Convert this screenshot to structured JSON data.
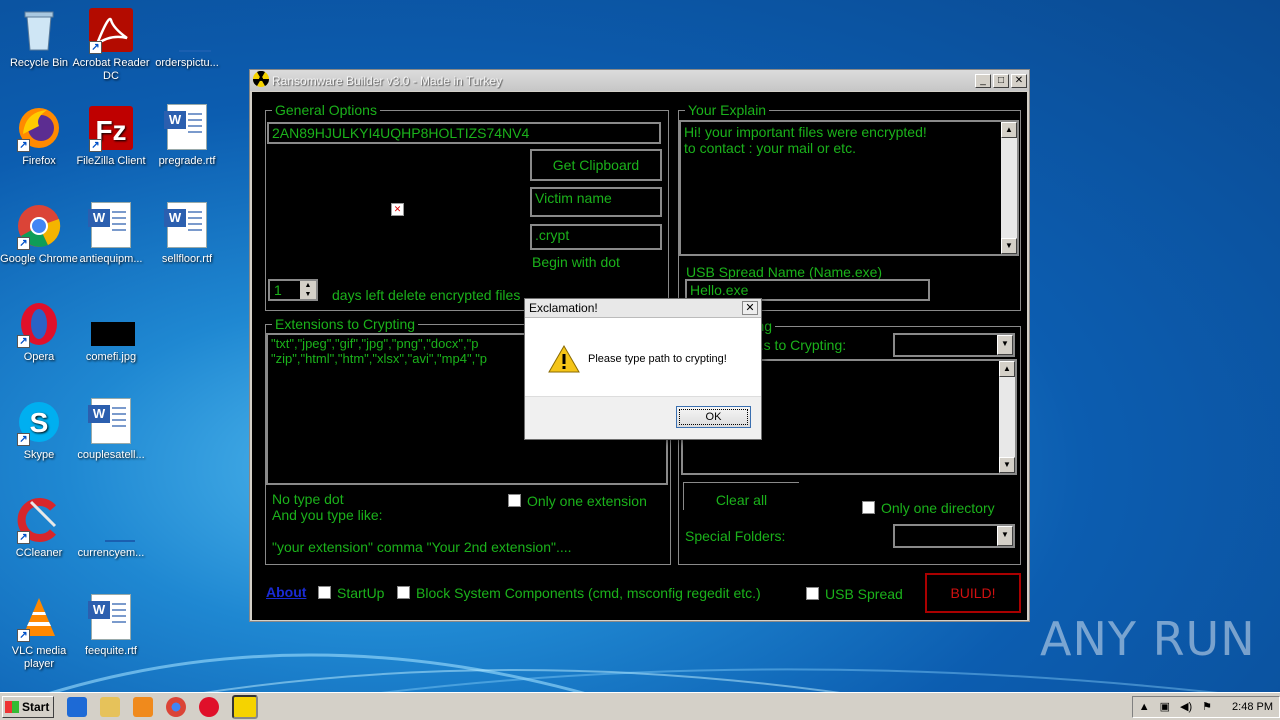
{
  "desktop": {
    "icons": [
      {
        "label": "Recycle Bin"
      },
      {
        "label": "Acrobat Reader DC"
      },
      {
        "label": "orderspictu..."
      },
      {
        "label": "Firefox"
      },
      {
        "label": "FileZilla Client"
      },
      {
        "label": "pregrade.rtf"
      },
      {
        "label": "Google Chrome"
      },
      {
        "label": "antiequipm..."
      },
      {
        "label": "sellfloor.rtf"
      },
      {
        "label": "Opera"
      },
      {
        "label": "comefi.jpg"
      },
      {
        "label": "Skype"
      },
      {
        "label": "couplesatell..."
      },
      {
        "label": "CCleaner"
      },
      {
        "label": "currencyem..."
      },
      {
        "label": "VLC media player"
      },
      {
        "label": "feequite.rtf"
      }
    ],
    "watermark": "ANY RUN"
  },
  "window": {
    "title": "Ransomware Builder v3.0 - Made in Turkey",
    "general_options": {
      "group_label": "General Options",
      "key_value": "2AN89HJULKYI4UQHP8HOLTIZS74NV4",
      "get_clipboard_label": "Get Clipboard",
      "victim_name_value": "Victim name",
      "extension_value": ".crypt",
      "begin_with_dot": "Begin with dot",
      "days_value": "1",
      "days_label": "days left delete encrypted files"
    },
    "your_explain": {
      "group_label": "Your Explain",
      "line1": "Hi! your important files were encrypted!",
      "line2": "to contact : your mail or etc."
    },
    "usb": {
      "spread_name_label": "USB Spread Name (Name.exe)",
      "spread_name_value": "Hello.exe"
    },
    "extensions": {
      "group_label": "Extensions to Crypting",
      "line1": "\"txt\",\"jpeg\",\"gif\",\"jpg\",\"png\",\"docx\",\"p",
      "line2": "\"zip\",\"html\",\"htm\",\"xlsx\",\"avi\",\"mp4\",\"p",
      "hint1": "No type dot",
      "hint2": "And you type like:",
      "hint3": "\"your extension\" comma \"Your 2nd extension\"....",
      "only_one_label": "Only one extension"
    },
    "directories": {
      "group_label": "...pting",
      "path_label": "...s to Crypting:",
      "clear_all_label": "Clear all",
      "only_one_dir_label": "Only one directory",
      "special_folders_label": "Special Folders:"
    },
    "footer": {
      "about_label": "About",
      "startup_label": "StartUp",
      "block_label": "Block System Components (cmd, msconfig regedit etc.)",
      "usb_spread_label": "USB Spread",
      "build_label": "BUILD!"
    }
  },
  "dialog": {
    "title": "Exclamation!",
    "message": "Please type path to crypting!",
    "ok_label": "OK"
  },
  "taskbar": {
    "start_label": "Start",
    "clock": "2:48 PM"
  }
}
